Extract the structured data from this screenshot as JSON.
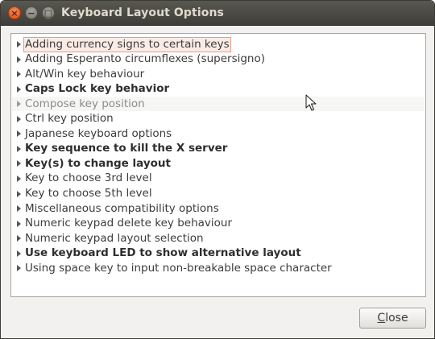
{
  "window": {
    "title": "Keyboard Layout Options",
    "controls": {
      "close_glyph": "×",
      "minimize_glyph": "−",
      "maximize_glyph": "□"
    }
  },
  "options": [
    {
      "label": "Adding currency signs to certain keys",
      "bold": false,
      "dim": false,
      "focused": true,
      "hover": false
    },
    {
      "label": "Adding Esperanto circumflexes (supersigno)",
      "bold": false,
      "dim": false,
      "focused": false,
      "hover": false
    },
    {
      "label": "Alt/Win key behaviour",
      "bold": false,
      "dim": false,
      "focused": false,
      "hover": false
    },
    {
      "label": "Caps Lock key behavior",
      "bold": true,
      "dim": false,
      "focused": false,
      "hover": false
    },
    {
      "label": "Compose key position",
      "bold": false,
      "dim": true,
      "focused": false,
      "hover": true
    },
    {
      "label": "Ctrl key position",
      "bold": false,
      "dim": false,
      "focused": false,
      "hover": false
    },
    {
      "label": "Japanese keyboard options",
      "bold": false,
      "dim": false,
      "focused": false,
      "hover": false
    },
    {
      "label": "Key sequence to kill the X server",
      "bold": true,
      "dim": false,
      "focused": false,
      "hover": false
    },
    {
      "label": "Key(s) to change layout",
      "bold": true,
      "dim": false,
      "focused": false,
      "hover": false
    },
    {
      "label": "Key to choose 3rd level",
      "bold": false,
      "dim": false,
      "focused": false,
      "hover": false
    },
    {
      "label": "Key to choose 5th level",
      "bold": false,
      "dim": false,
      "focused": false,
      "hover": false
    },
    {
      "label": "Miscellaneous compatibility options",
      "bold": false,
      "dim": false,
      "focused": false,
      "hover": false
    },
    {
      "label": "Numeric keypad delete key behaviour",
      "bold": false,
      "dim": false,
      "focused": false,
      "hover": false
    },
    {
      "label": "Numeric keypad layout selection",
      "bold": false,
      "dim": false,
      "focused": false,
      "hover": false
    },
    {
      "label": "Use keyboard LED to show alternative layout",
      "bold": true,
      "dim": false,
      "focused": false,
      "hover": false
    },
    {
      "label": "Using space key to input non-breakable space character",
      "bold": false,
      "dim": false,
      "focused": false,
      "hover": false
    }
  ],
  "buttons": {
    "close": {
      "mnemonic": "C",
      "rest": "lose"
    }
  },
  "colors": {
    "titlebar": "#3e3d39",
    "close_button": "#df4a16",
    "focus_outline": "#e59d84"
  },
  "icons": {
    "expander": "triangle-right-icon",
    "pointer": "mouse-pointer-icon"
  }
}
